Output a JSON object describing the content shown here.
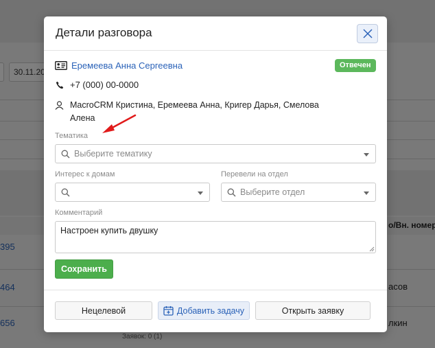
{
  "background": {
    "date_field": "30.11.20",
    "column_header": "о/Вн. номер",
    "row_numbers": [
      "395",
      "464",
      "656"
    ],
    "row_right_texts": [
      "асов",
      "лкин"
    ],
    "footer_count": "Заявок: 0 (1)"
  },
  "modal": {
    "title": "Детали разговора",
    "contact_name": "Еремеева Анна Сергеевна",
    "status": "Отвечен",
    "phone": "+7 (000) 00-0000",
    "participants": "MacroCRM Кристина, Еремеева Анна, Кригер Дарья, Смелова Алена",
    "topic": {
      "label": "Тематика",
      "placeholder": "Выберите тематику"
    },
    "interest": {
      "label": "Интерес к домам",
      "placeholder": ""
    },
    "department": {
      "label": "Перевели на отдел",
      "placeholder": "Выберите отдел"
    },
    "comment": {
      "label": "Комментарий",
      "value": "Настроен купить двушку"
    },
    "save_label": "Сохранить",
    "footer": {
      "nontarget_label": "Нецелевой",
      "add_task_label": "Добавить задачу",
      "open_request_label": "Открыть заявку"
    }
  },
  "colors": {
    "accent_blue": "#2a62b8",
    "status_green": "#5cb85c",
    "save_green": "#4cae4c",
    "annotation_red": "#e11b1b"
  }
}
